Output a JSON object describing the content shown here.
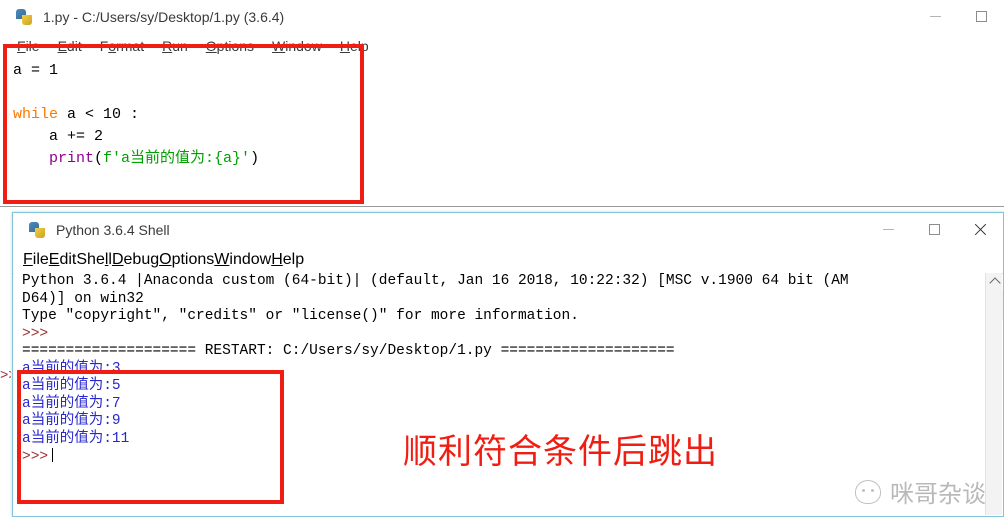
{
  "editor_window": {
    "title": "1.py - C:/Users/sy/Desktop/1.py (3.6.4)",
    "icon": "python-file-icon",
    "menu": [
      "File",
      "Edit",
      "Format",
      "Run",
      "Options",
      "Window",
      "Help"
    ],
    "controls": {
      "minimize": "minimize-icon",
      "maximize": "maximize-icon"
    },
    "code_lines": [
      "a = 1",
      "",
      "while a < 10 :",
      "    a += 2",
      "    print(f'a当前的值为:{a}')"
    ],
    "code_plain": "a = 1\n\nwhile a < 10 :\n    a += 2\n    print(f'a当前的值为:{a}')",
    "syntax_colors": {
      "keyword": "#ff7700",
      "builtin": "#900090",
      "string": "#00a000",
      "default": "#000000"
    }
  },
  "shell_window": {
    "title": "Python 3.6.4 Shell",
    "icon": "python-shell-icon",
    "menu": [
      "File",
      "Edit",
      "Shell",
      "Debug",
      "Options",
      "Window",
      "Help"
    ],
    "controls": {
      "minimize": "minimize-icon",
      "maximize": "maximize-icon",
      "close": "close-icon"
    },
    "banner_lines": [
      "Python 3.6.4 |Anaconda custom (64-bit)| (default, Jan 16 2018, 10:22:32) [MSC v.1900 64 bit (AM",
      "D64)] on win32",
      "Type \"copyright\", \"credits\" or \"license()\" for more information."
    ],
    "prompt": ">>>",
    "restart_line": "==================== RESTART: C:/Users/sy/Desktop/1.py ====================",
    "output_lines": [
      "a当前的值为:3",
      "a当前的值为:5",
      "a当前的值为:7",
      "a当前的值为:9",
      "a当前的值为:11"
    ],
    "final_prompt": ">>>",
    "output_color": "#2727d0",
    "prompt_color": "#a03030",
    "scrollbar": {
      "up_arrow": "chevron-up-icon"
    },
    "editor_prompt_sliver": ">>>"
  },
  "annotations": {
    "note_text": "顺利符合条件后跳出",
    "note_color": "#f01d12",
    "box_color": "#f01d12",
    "boxes": [
      "code-region-highlight",
      "output-region-highlight"
    ]
  },
  "watermark": {
    "text": "咪哥杂谈",
    "icon": "cat-face-icon",
    "color": "#8f8f8f"
  }
}
